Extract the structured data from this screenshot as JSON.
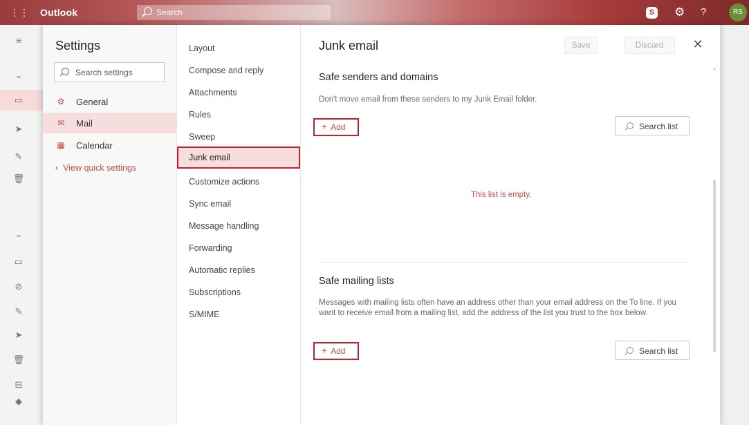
{
  "topbar": {
    "brand": "Outlook",
    "search_placeholder": "Search",
    "skype_glyph": "S",
    "help_glyph": "?",
    "avatar_initials": "RS"
  },
  "settings": {
    "title": "Settings",
    "search_placeholder": "Search settings",
    "categories": [
      {
        "label": "General",
        "icon": "gear-icon"
      },
      {
        "label": "Mail",
        "icon": "envelope-icon"
      },
      {
        "label": "Calendar",
        "icon": "calendar-icon"
      }
    ],
    "quick_settings_link": "View quick settings"
  },
  "mail_nav": {
    "items": [
      "Layout",
      "Compose and reply",
      "Attachments",
      "Rules",
      "Sweep",
      "Junk email",
      "Customize actions",
      "Sync email",
      "Message handling",
      "Forwarding",
      "Automatic replies",
      "Subscriptions",
      "S/MIME"
    ],
    "selected": "Junk email"
  },
  "junk": {
    "title": "Junk email",
    "save_label": "Save",
    "discard_label": "Discard",
    "safe_senders": {
      "title": "Safe senders and domains",
      "description": "Don't move email from these senders to my Junk Email folder.",
      "add_label": "Add",
      "search_label": "Search list",
      "empty_text": "This list is empty."
    },
    "safe_mailing": {
      "title": "Safe mailing lists",
      "description": "Messages with mailing lists often have an address other than your email address on the To line. If you want to receive email from a mailing list, add the address of the list you trust to the box below.",
      "add_label": "Add",
      "search_label": "Search list"
    }
  },
  "colors": {
    "accent": "#c0504d",
    "highlight_border": "#c8202a",
    "selected_bg": "#f7dede"
  }
}
